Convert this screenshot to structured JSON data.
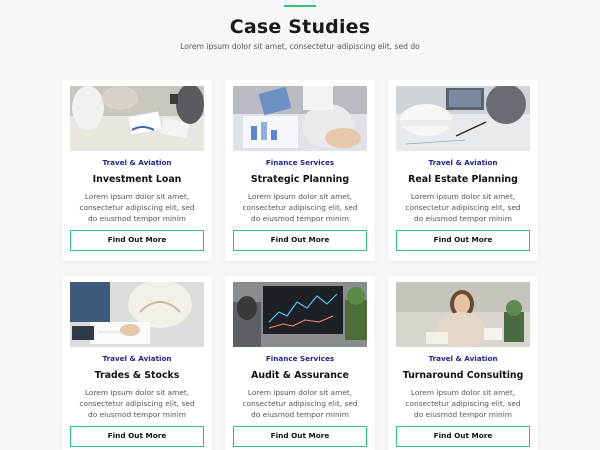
{
  "header": {
    "title": "Case Studies",
    "subtitle": "Lorem ipsum dolor sit amet, consectetur adipiscing elit, sed do"
  },
  "colors": {
    "accent": "#2ec27e",
    "category": "#23238c"
  },
  "cards": [
    {
      "category": "Travel & Aviation",
      "title": "Investment Loan",
      "description": "Lorem ipsum dolor sit amet, consectetur adipiscing elit, sed do eiusmod tempor minim",
      "button": "Find Out More",
      "image_icon": "office-meeting-photo"
    },
    {
      "category": "Finance Services",
      "title": "Strategic Planning",
      "description": "Lorem ipsum dolor sit amet, consectetur adipiscing elit, sed do eiusmod tempor minim",
      "button": "Find Out More",
      "image_icon": "charts-review-photo"
    },
    {
      "category": "Travel & Aviation",
      "title": "Real Estate Planning",
      "description": "Lorem ipsum dolor sit amet, consectetur adipiscing elit, sed do eiusmod tempor minim",
      "button": "Find Out More",
      "image_icon": "blueprint-helmet-photo"
    },
    {
      "category": "Travel & Aviation",
      "title": "Trades & Stocks",
      "description": "Lorem ipsum dolor sit amet, consectetur adipiscing elit, sed do eiusmod tempor minim",
      "button": "Find Out More",
      "image_icon": "signing-document-photo"
    },
    {
      "category": "Finance Services",
      "title": "Audit & Assurance",
      "description": "Lorem ipsum dolor sit amet, consectetur adipiscing elit, sed do eiusmod tempor minim",
      "button": "Find Out More",
      "image_icon": "trading-screen-photo"
    },
    {
      "category": "Travel & Aviation",
      "title": "Turnaround Consulting",
      "description": "Lorem ipsum dolor sit amet, consectetur adipiscing elit, sed do eiusmod tempor minim",
      "button": "Find Out More",
      "image_icon": "woman-with-tea-photo"
    }
  ]
}
